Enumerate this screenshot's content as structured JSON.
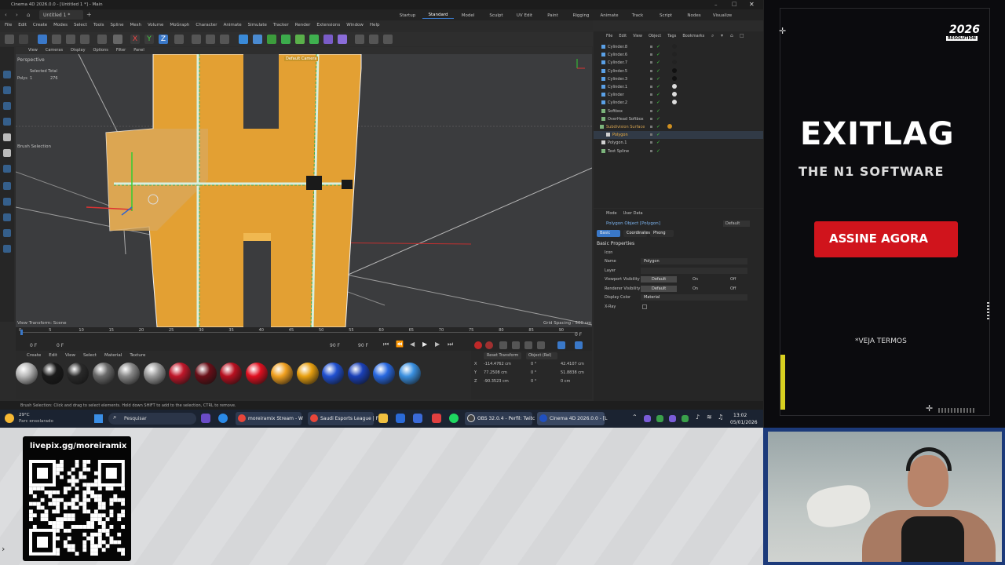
{
  "window": {
    "title": "Cinema 4D 2026.0.0 - [Untitled 1 *] - Main",
    "doc_tab": "Untitled 1 *"
  },
  "layout_tabs": [
    "Startup",
    "Standard",
    "Model",
    "Sculpt",
    "UV Edit",
    "Paint",
    "Rigging",
    "Animate",
    "Track",
    "Script",
    "Nodes",
    "Visualize"
  ],
  "active_layout": "Standard",
  "menu": [
    "File",
    "Edit",
    "Create",
    "Modes",
    "Select",
    "Tools",
    "Spline",
    "Mesh",
    "Volume",
    "MoGraph",
    "Character",
    "Animate",
    "Simulate",
    "Tracker",
    "Render",
    "Extensions",
    "Window",
    "Help"
  ],
  "viewport": {
    "menu": [
      "View",
      "Cameras",
      "Display",
      "Options",
      "Filter",
      "Panel"
    ],
    "label": "Perspective",
    "camera": "Default Camera",
    "hud_header": "Selected Total",
    "hud_row_label": "Polys",
    "hud_selected": "1",
    "hud_total": "276",
    "tool_label": "Brush Selection",
    "transform": "View Transform: Scene",
    "grid": "Grid Spacing : 500 cm"
  },
  "timeline": {
    "ticks": [
      "0",
      "5",
      "10",
      "15",
      "20",
      "25",
      "30",
      "35",
      "40",
      "45",
      "50",
      "55",
      "60",
      "65",
      "70",
      "75",
      "80",
      "85",
      "90"
    ],
    "start": "0 F",
    "current": "0 F",
    "end_a": "90 F",
    "end_b": "90 F",
    "frame_right": "0 F"
  },
  "materials": {
    "menu": [
      "Create",
      "Edit",
      "View",
      "Select",
      "Material",
      "Texture"
    ],
    "balls": [
      "#b8b8b8",
      "#1a1a1a",
      "#2a2a2a",
      "#6a6a6a",
      "#888888",
      "#9a9a9a",
      "#c0172a",
      "#6a0f18",
      "#b81020",
      "#e01020",
      "#f0a020",
      "#e8a010",
      "#2050d0",
      "#1a40b8",
      "#2868e0",
      "#3a90e0"
    ]
  },
  "coords": {
    "reset": "Reset Transform",
    "mode": "Object (Rel)",
    "rows": [
      {
        "axis": "X",
        "pos": "-114.4762 cm",
        "rot": "0 °",
        "size": "42.4107 cm"
      },
      {
        "axis": "Y",
        "pos": "77.2508 cm",
        "rot": "0 °",
        "size": "51.8838 cm"
      },
      {
        "axis": "Z",
        "pos": "-90.3523 cm",
        "rot": "0 °",
        "size": "0 cm"
      }
    ]
  },
  "objects": {
    "menu": [
      "File",
      "Edit",
      "View",
      "Object",
      "Tags",
      "Bookmarks"
    ],
    "items": [
      "Cylinder.8",
      "Cylinder.6",
      "Cylinder.7",
      "Cylinder.5",
      "Cylinder.3",
      "Cylinder.1",
      "Cylinder",
      "Cylinder.2",
      "Softbox",
      "OverHead Softbox",
      "Subdivision Surface",
      "Polygon",
      "Polygon.1",
      "Text Spline"
    ]
  },
  "attributes": {
    "menu": [
      "Mode",
      "User Data"
    ],
    "object": "Polygon Object [Polygon]",
    "preset": "Default",
    "tabs": [
      "Basic",
      "Coordinates",
      "Phong"
    ],
    "section": "Basic Properties",
    "icon_label": "Icon",
    "rows": [
      {
        "label": "Name",
        "value": "Polygon"
      },
      {
        "label": "Layer",
        "value": ""
      },
      {
        "label": "Viewport Visibility",
        "value": "Default",
        "on": "On",
        "off": "Off"
      },
      {
        "label": "Renderer Visibility",
        "value": "Default",
        "on": "On",
        "off": "Off"
      },
      {
        "label": "Display Color",
        "value": "Material"
      },
      {
        "label": "X-Ray",
        "value": ""
      }
    ]
  },
  "status": "Brush Selection: Click and drag to select elements. Hold down SHIFT to add to the selection, CTRL to remove.",
  "taskbar": {
    "weather_temp": "29°C",
    "weather_desc": "Parc ensolarado",
    "search": "Pesquisar",
    "apps": [
      "moreiramix Stream - W",
      "Saudi Esports League | F",
      "OBS 32.0.4 - Perfil: Twitc",
      "Cinema 4D 2026.0.0 - [L"
    ],
    "time": "13:02",
    "date": "05/01/2026"
  },
  "ad": {
    "brand": "EXITLAG",
    "tagline": "THE N1 SOFTWARE",
    "cta": "ASSINE AGORA",
    "terms": "*VEJA TERMOS",
    "badge_line1": "2026",
    "badge_line2": "RESOLUTION",
    "colors": {
      "cta": "#d0141c",
      "accent": "#ffffff"
    }
  },
  "qr": {
    "url": "livepix.gg/moreiramix"
  }
}
